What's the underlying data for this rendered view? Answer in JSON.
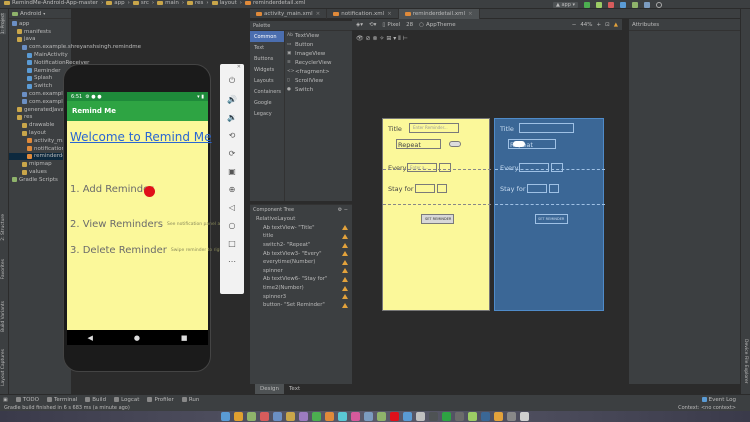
{
  "breadcrumbs": [
    "RemindMe-Android-App-master",
    "app",
    "src",
    "main",
    "res",
    "layout",
    "reminderdetail.xml"
  ],
  "run_config": "app",
  "editor_tabs": [
    {
      "label": "activity_main.xml",
      "active": false
    },
    {
      "label": "notification.xml",
      "active": false
    },
    {
      "label": "reminderdetail.xml",
      "active": true
    }
  ],
  "project": {
    "view": "Android",
    "items": [
      {
        "label": "app",
        "indent": 0,
        "color": "#6b8fc4"
      },
      {
        "label": "manifests",
        "indent": 1,
        "color": "#c9a64a"
      },
      {
        "label": "java",
        "indent": 1,
        "color": "#c9a64a"
      },
      {
        "label": "com.example.shreyanshsingh.remindme",
        "indent": 2,
        "color": "#6b8fc4"
      },
      {
        "label": "MainActivity",
        "indent": 3,
        "color": "#5a9bd5"
      },
      {
        "label": "NotificationReceiver",
        "indent": 3,
        "color": "#5a9bd5"
      },
      {
        "label": "Reminder",
        "indent": 3,
        "color": "#5a9bd5"
      },
      {
        "label": "Splash",
        "indent": 3,
        "color": "#5a9bd5"
      },
      {
        "label": "Switch",
        "indent": 3,
        "color": "#5a9bd5"
      },
      {
        "label": "com.example",
        "indent": 2,
        "color": "#6b8fc4"
      },
      {
        "label": "com.example",
        "indent": 2,
        "color": "#6b8fc4"
      },
      {
        "label": "generatedJava",
        "indent": 1,
        "color": "#c9a64a"
      },
      {
        "label": "res",
        "indent": 1,
        "color": "#c9a64a"
      },
      {
        "label": "drawable",
        "indent": 2,
        "color": "#c9a64a"
      },
      {
        "label": "layout",
        "indent": 2,
        "color": "#c9a64a"
      },
      {
        "label": "activity_main.xml",
        "indent": 3,
        "color": "#e08a3a"
      },
      {
        "label": "notification.xml",
        "indent": 3,
        "color": "#e08a3a"
      },
      {
        "label": "reminderdetail.xml",
        "indent": 3,
        "color": "#e08a3a",
        "selected": true
      },
      {
        "label": "mipmap",
        "indent": 2,
        "color": "#c9a64a"
      },
      {
        "label": "values",
        "indent": 2,
        "color": "#c9a64a"
      },
      {
        "label": "Gradle Scripts",
        "indent": 0,
        "color": "#8fb36b"
      }
    ]
  },
  "left_tabs": [
    "1: Project",
    "2: Structure",
    "Favorites",
    "Build Variants",
    "Layout Captures"
  ],
  "phone": {
    "time": "6:51",
    "app_title": "Remind Me",
    "welcome": "Welcome to Remind Me",
    "items": [
      {
        "label": "1. Add Reminder",
        "hint": ""
      },
      {
        "label": "2. View Reminders",
        "hint": "See notification panel above"
      },
      {
        "label": "3. Delete Reminder",
        "hint": "Swipe reminder to right / left"
      }
    ],
    "dot_color": "#e0101a"
  },
  "emulator_controls": [
    "power-icon",
    "volume-up-icon",
    "volume-down-icon",
    "rotate-left-icon",
    "rotate-right-icon",
    "camera-icon",
    "zoom-in-icon",
    "back-icon",
    "home-icon",
    "overview-icon",
    "more-icon"
  ],
  "palette": {
    "title": "Palette",
    "categories": [
      "Common",
      "Text",
      "Buttons",
      "Widgets",
      "Layouts",
      "Containers",
      "Google",
      "Legacy"
    ],
    "items": [
      {
        "icon": "Ab",
        "label": "TextView"
      },
      {
        "icon": "▭",
        "label": "Button"
      },
      {
        "icon": "▣",
        "label": "ImageView"
      },
      {
        "icon": "≡",
        "label": "RecyclerView"
      },
      {
        "icon": "<>",
        "label": "<fragment>"
      },
      {
        "icon": "▯",
        "label": "ScrollView"
      },
      {
        "icon": "●",
        "label": "Switch"
      }
    ]
  },
  "component_tree": {
    "title": "Component Tree",
    "items": [
      {
        "label": "RelativeLayout",
        "warn": false,
        "indent": 0
      },
      {
        "label": "Ab textView- \"Title\"",
        "warn": true,
        "indent": 1
      },
      {
        "label": "title",
        "warn": true,
        "indent": 1
      },
      {
        "label": "switch2- \"Repeat\"",
        "warn": true,
        "indent": 1
      },
      {
        "label": "Ab textView3- \"Every\"",
        "warn": true,
        "indent": 1
      },
      {
        "label": "everytime(Number)",
        "warn": true,
        "indent": 1
      },
      {
        "label": "spinner",
        "warn": true,
        "indent": 1
      },
      {
        "label": "Ab textView6- \"Stay for\"",
        "warn": true,
        "indent": 1
      },
      {
        "label": "time2(Number)",
        "warn": true,
        "indent": 1
      },
      {
        "label": "spinner3",
        "warn": true,
        "indent": 1
      },
      {
        "label": "button- \"Set Reminder\"",
        "warn": true,
        "indent": 1
      }
    ]
  },
  "design_toolbar": {
    "device": "Pixel",
    "api": "28",
    "theme": "AppTheme",
    "zoom": "44%"
  },
  "attributes_title": "Attributes",
  "blueprint": {
    "title_label": "Title",
    "title_hint": "Enter Reminder...",
    "repeat_label": "Repeat",
    "every_label": "Every",
    "every_hint": "Enter a...",
    "stay_label": "Stay for",
    "button": "SET REMINDER"
  },
  "design_tabs": [
    "Design",
    "Text"
  ],
  "bottom_tools": [
    "TODO",
    "Terminal",
    "Build",
    "Logcat",
    "Profiler",
    "Run"
  ],
  "event_log": "Event Log",
  "status": "Gradle build finished in 6 s 683 ms (a minute ago)",
  "context": "Context: <no context>",
  "right_tabs": [
    "Device File Explorer"
  ]
}
